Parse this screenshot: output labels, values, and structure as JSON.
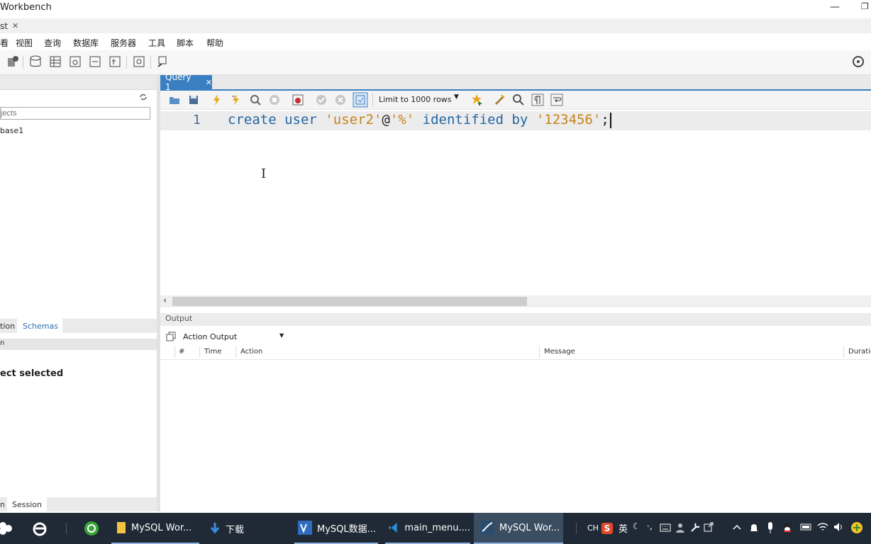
{
  "window": {
    "title": "Workbench",
    "minimize_glyph": "—",
    "maximize_glyph": "❐"
  },
  "connection_tab": {
    "label": "st",
    "close": "✕"
  },
  "menu": [
    "看",
    "视图",
    "查询",
    "数据库",
    "服务器",
    "工具",
    "脚本",
    "帮助"
  ],
  "navigator": {
    "filter_placeholder": "jects",
    "schema_item": "base1",
    "tabs": [
      "tion",
      "Schemas"
    ],
    "info_header": "n",
    "no_selection": "ect selected",
    "session_tabs": [
      "n",
      "Session"
    ]
  },
  "editor": {
    "tab_label": "Query 1",
    "tab_close": "✕",
    "limit_label": "Limit to 1000 rows",
    "line_number": "1",
    "tokens": {
      "t1": "create",
      "t2": "user",
      "t3": "'user2'",
      "t4": "@",
      "t5": "'%'",
      "t6": "identified",
      "t7": "by",
      "t8": "'123456'",
      "t9": ";"
    },
    "scroll_left": "‹"
  },
  "output": {
    "header": "Output",
    "mode": "Action Output",
    "columns": [
      "#",
      "Time",
      "Action",
      "Message",
      "Duratio"
    ]
  },
  "taskbar": {
    "items": [
      "MySQL Wor...",
      "下载",
      "MySQL数据...",
      "main_menu....",
      "MySQL Wor..."
    ],
    "tray": {
      "ime": "CH",
      "lang": "英",
      "sogou": "S"
    }
  },
  "colors": {
    "accent": "#3a7fc1",
    "keyword": "#2466a4",
    "string": "#c7821b",
    "taskbar": "#1f2a36"
  }
}
